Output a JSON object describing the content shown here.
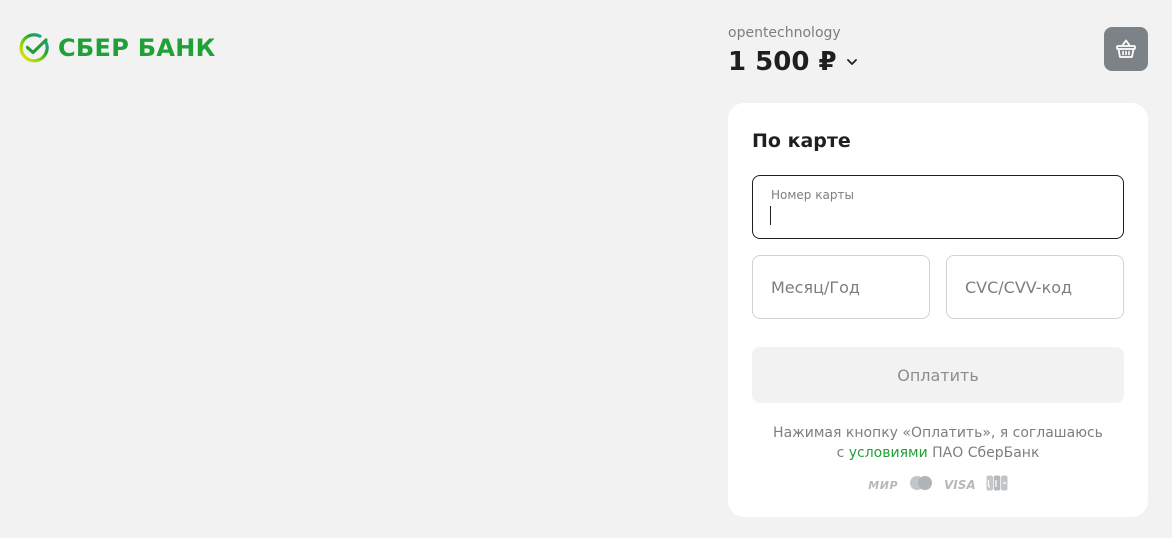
{
  "brand": {
    "name": "СБЕР БАНК",
    "color": "#21a038"
  },
  "order": {
    "merchant": "opentechnology",
    "amount": "1 500 ₽"
  },
  "payment_form": {
    "title": "По карте",
    "card_number_label": "Номер карты",
    "card_number_value": "",
    "expiry_placeholder": "Месяц/Год",
    "cvc_placeholder": "CVC/CVV-код",
    "pay_button_label": "Оплатить",
    "terms_line1": "Нажимая кнопку «Оплатить», я соглашаюсь",
    "terms_prefix": "с ",
    "terms_link": "условиями",
    "terms_suffix": " ПАО СберБанк",
    "payment_systems": {
      "mir": "МИР",
      "visa": "VISA"
    }
  },
  "icons": {
    "logo": "sber-checkmark-icon",
    "basket": "basket-icon",
    "chevron": "chevron-down-icon",
    "mastercard": "mastercard-icon",
    "jcb": "jcb-icon"
  },
  "colors": {
    "background": "#f1f2f1",
    "panel": "#ffffff",
    "accent": "#21a038",
    "basket_button": "#7d8286",
    "pay_button_disabled": "#f2f2f2"
  }
}
